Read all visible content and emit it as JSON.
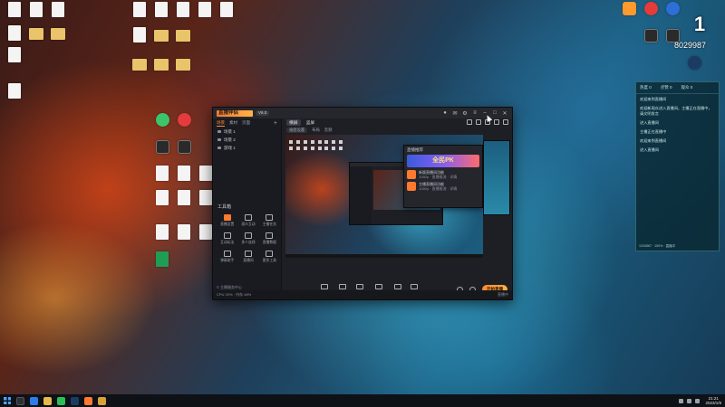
{
  "colors": {
    "accent": "#ff7a2f",
    "window_bg": "#1e1f24",
    "panel_bg": "#1a1b20",
    "side_panel_bg": "#0a2832"
  },
  "desktop": {
    "left_icons": [
      {
        "label": "",
        "icon": "doc-icon"
      },
      {
        "label": "",
        "icon": "doc-icon"
      },
      {
        "label": "",
        "icon": "doc-icon"
      },
      {
        "label": "",
        "icon": "doc-icon"
      },
      {
        "label": "",
        "icon": "doc-icon"
      },
      {
        "label": "",
        "icon": "doc-icon"
      },
      {
        "label": "",
        "icon": "doc-icon"
      },
      {
        "label": "",
        "icon": "doc-icon"
      },
      {
        "label": "",
        "icon": "doc-icon"
      },
      {
        "label": "",
        "icon": "doc-icon"
      },
      {
        "label": "",
        "icon": "doc-icon"
      },
      {
        "label": "",
        "icon": "doc-icon"
      },
      {
        "label": "",
        "icon": "doc-icon"
      },
      {
        "label": "",
        "icon": "doc-icon"
      },
      {
        "label": "",
        "icon": "doc-icon"
      }
    ],
    "right_icons": [
      {
        "label": "",
        "icon": "app-icon"
      },
      {
        "label": "",
        "icon": "app-icon"
      },
      {
        "label": "",
        "icon": "app-icon"
      },
      {
        "label": "",
        "icon": "app-icon"
      },
      {
        "label": "",
        "icon": "app-icon"
      },
      {
        "label": "",
        "icon": "steam-icon"
      }
    ],
    "widget_time": "1",
    "widget_score": "8029987"
  },
  "app": {
    "version": "V6.0",
    "logo_text": "直播伴侣",
    "left_tabs": [
      "场景",
      "素材",
      "页面"
    ],
    "scenes": [
      "场景 1",
      "场景 2",
      "游戏 1"
    ],
    "tools_title": "工具箱",
    "tools": [
      {
        "label": "直播设置",
        "icon": "live-settings-icon"
      },
      {
        "label": "观众互动",
        "icon": "audience-icon"
      },
      {
        "label": "主播任务",
        "icon": "task-icon"
      },
      {
        "label": "互动玩法",
        "icon": "play-icon"
      },
      {
        "label": "多人连线",
        "icon": "multi-link-icon"
      },
      {
        "label": "直播数据",
        "icon": "data-icon"
      },
      {
        "label": "弹幕助手",
        "icon": "danmaku-icon"
      },
      {
        "label": "直播间",
        "icon": "room-icon"
      },
      {
        "label": "更多工具",
        "icon": "more-tools-icon"
      }
    ],
    "left_footer": "© 主播服务中心",
    "center_tabs": [
      "横屏",
      "竖屏"
    ],
    "center_sub": [
      "画面设置",
      "布局",
      "音频"
    ],
    "notice": {
      "head": "直播推荐",
      "banner": "全民PK",
      "items": [
        {
          "title": "新版直播间功能",
          "meta": "1080p · 直播推流 · 详情"
        },
        {
          "title": "主播直播间功能",
          "meta": "1080p · 直播推流 · 详情"
        }
      ]
    },
    "bottom_tools": [
      {
        "label": "直播特效",
        "icon": "effects-icon"
      },
      {
        "label": "粉丝团",
        "icon": "fans-icon"
      },
      {
        "label": "连线PK",
        "icon": "pk-icon"
      },
      {
        "label": "直播礼物",
        "icon": "gift-icon"
      },
      {
        "label": "麦克风",
        "icon": "mic-icon"
      },
      {
        "label": "扬声器",
        "icon": "speaker-icon"
      }
    ],
    "live_button": "开始直播",
    "status_left": "CPU 20% · 内存 48%",
    "status_right": "直播中"
  },
  "side_panel": {
    "tabs": [
      "热度 0",
      "点赞 0",
      "观众 0"
    ],
    "messages": [
      "欢迎来到直播间",
      "欢迎新观众进入直播间，主播正在直播中，请文明发言",
      "进入直播间",
      "主播正在直播中",
      "欢迎来到直播间",
      "进入直播间"
    ],
    "footer": "1234567 · 100% · 直播中"
  },
  "taskbar": {
    "icons": [
      "start-icon",
      "search-icon",
      "browser-icon",
      "folder-icon",
      "wechat-icon",
      "steam-icon",
      "app-icon",
      "app-icon"
    ],
    "time": "21:21",
    "date": "2023/1/9"
  }
}
